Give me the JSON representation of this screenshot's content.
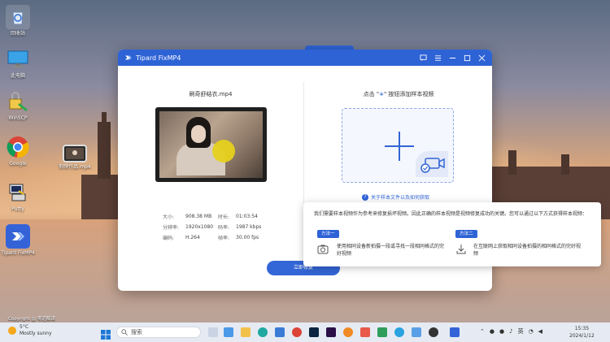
{
  "desktop": {
    "icons": [
      {
        "label": "回收站",
        "icon": "recycle-bin-icon"
      },
      {
        "label": "此电脑",
        "icon": "monitor-icon"
      },
      {
        "label": "WinSCP",
        "icon": "winscp-icon"
      },
      {
        "label": "Google",
        "icon": "chrome-icon"
      },
      {
        "label": "Putty",
        "icon": "putty-icon"
      },
      {
        "label": "Tipard FixMP4",
        "icon": "tipard-icon"
      },
      {
        "label": "剪映作品.mp4",
        "icon": "video-file-icon"
      }
    ],
    "copyright": "Copyright @ 零道解读"
  },
  "window": {
    "title": "Tipard FixMP4",
    "left": {
      "file_name": "刷奇舒结衣.mp4",
      "meta": [
        {
          "k1": "大小:",
          "v1": "908.38 MB",
          "k2": "时长:",
          "v2": "01:03:54"
        },
        {
          "k1": "分辨率:",
          "v1": "1920x1080",
          "k2": "码率:",
          "v2": "1987 kbps"
        },
        {
          "k1": "编码:",
          "v1": "H.264",
          "k2": "帧率:",
          "v2": "30.00 fps"
        }
      ]
    },
    "right": {
      "title_prefix": "点击 \"",
      "title_plus": "+",
      "title_suffix": "\" 按钮添加样本视频",
      "help_link": "关于样本文件以及如何获取"
    },
    "repair_button": "立即修复"
  },
  "popup": {
    "text": "我们需要样本视频作为参考来修复损坏视频。因此正确的样本视频是视频修复成功的关键。您可以通过以下方式获得样本视频：",
    "method1_tag": "方法一",
    "method1_text": "使用相同设备新拍摄一段或寻找一段相同格式的完好视频",
    "method2_tag": "方法二",
    "method2_text": "在互联网上获取相同设备拍摄的相同格式的完好视频"
  },
  "taskbar": {
    "weather_temp": "5°C",
    "weather_desc": "Mostly sunny",
    "search_placeholder": "搜索",
    "lang": "英",
    "time": "15:35",
    "date": "2024/1/12"
  },
  "colors": {
    "accent": "#2e63d6"
  }
}
